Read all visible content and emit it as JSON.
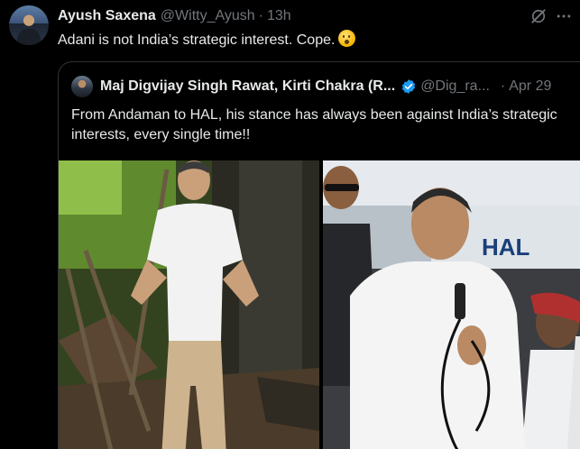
{
  "post": {
    "author_name": "Ayush Saxena",
    "author_handle": "@Witty_Ayush",
    "separator": "·",
    "time": "13h",
    "text": "Adani is not India’s strategic interest. Cope.",
    "emoji": "hushed-face-emoji"
  },
  "icons": {
    "grok": "grok-icon",
    "more": "more-icon",
    "verified": "verified-badge-icon"
  },
  "quoted_post": {
    "author_name": "Maj Digvijay Singh Rawat, Kirti Chakra (R...",
    "author_handle": "@Dig_ra...",
    "separator": "·",
    "time": "Apr 29",
    "text": "From Andaman to HAL, his stance has always been against India’s strategic interests, every single time!!",
    "media_right_sign": "HAL"
  },
  "colors": {
    "background": "#000000",
    "text_primary": "#e7e9ea",
    "text_secondary": "#71767b",
    "border": "#2f3336",
    "verified_blue": "#1d9bf0"
  }
}
